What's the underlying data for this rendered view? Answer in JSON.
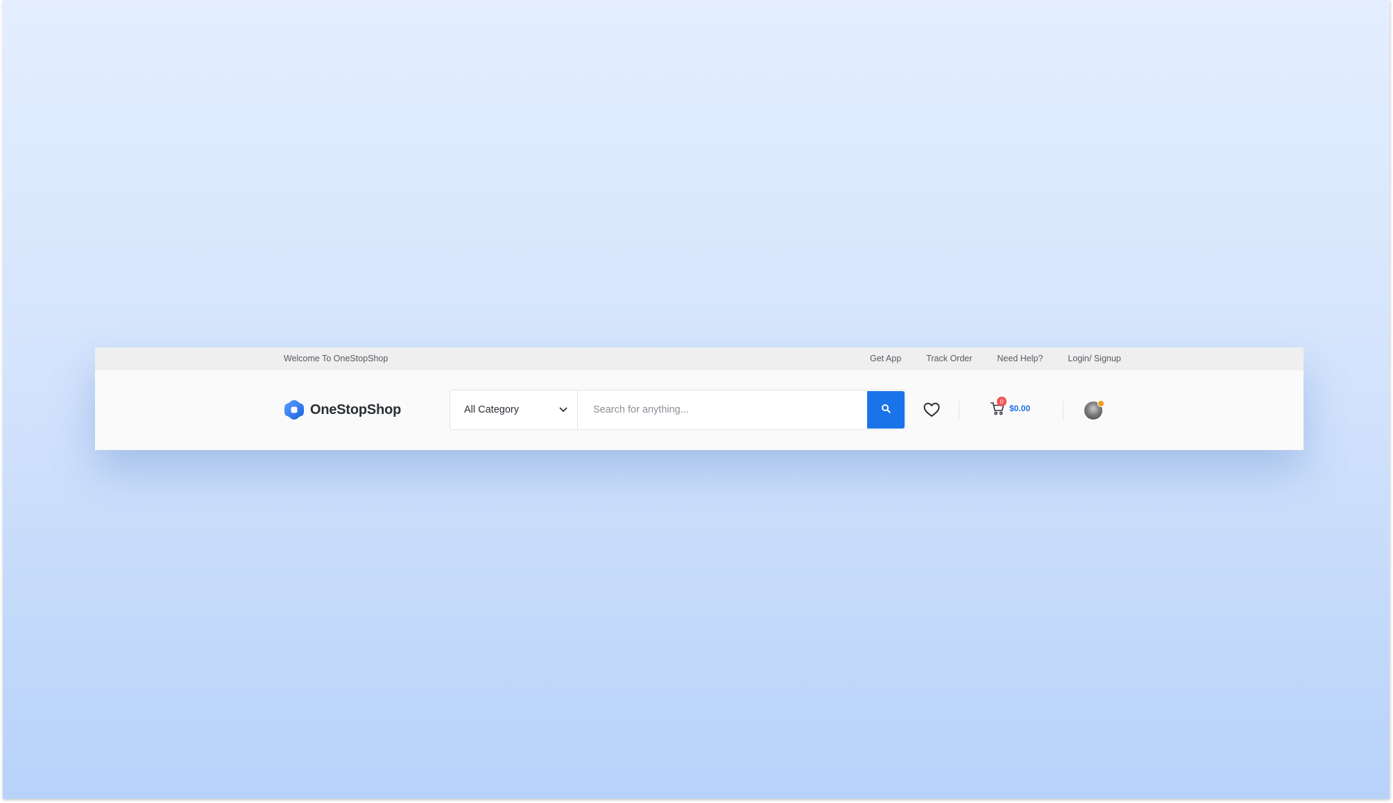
{
  "topbar": {
    "welcome": "Welcome To OneStopShop",
    "links": [
      "Get App",
      "Track Order",
      "Need Help?",
      "Login/ Signup"
    ]
  },
  "logo": {
    "text": "OneStopShop"
  },
  "search": {
    "category": "All Category",
    "placeholder": "Search for anything..."
  },
  "cart": {
    "count": "0",
    "total": "$0.00"
  },
  "colors": {
    "accent": "#1a73e8",
    "badge": "#f05454",
    "status_dot": "#f29a1f",
    "topbar_bg": "#efefef",
    "background_gradient_top": "#e4eeff",
    "background_gradient_bottom": "#b8d2fa"
  },
  "icons": {
    "logo": "logo-icon",
    "dropdown": "chevron-down-icon",
    "search": "search-icon",
    "wishlist": "heart-icon",
    "cart": "cart-icon",
    "avatar": "user-avatar"
  }
}
